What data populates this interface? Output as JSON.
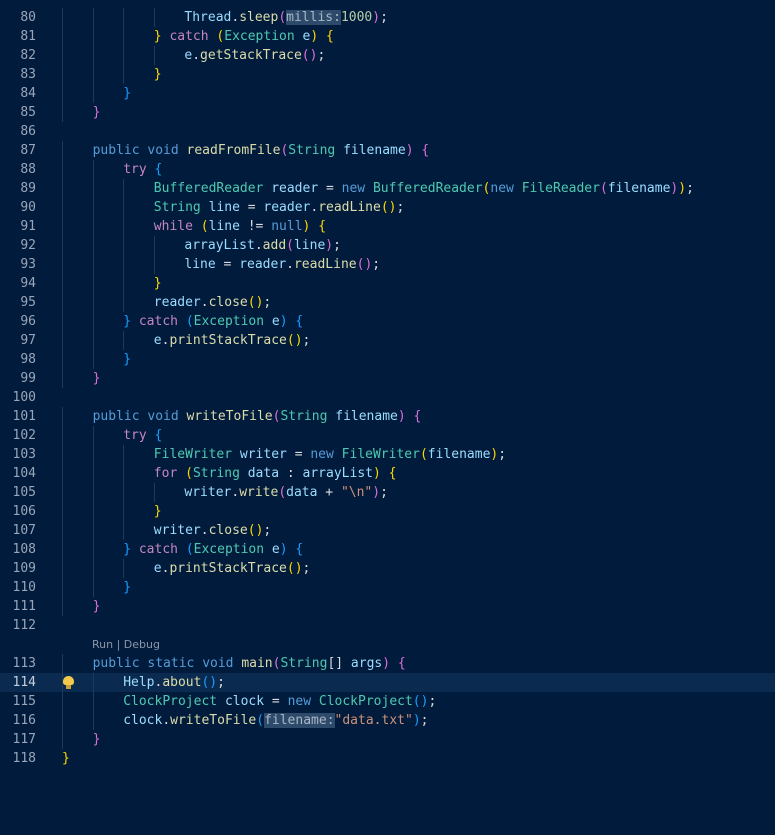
{
  "editor": {
    "current_line": 114,
    "codelens": "Run | Debug",
    "lines": [
      {
        "num": 80,
        "indent": 4,
        "tokens": [
          [
            "Thread",
            "v"
          ],
          [
            ".",
            ""
          ],
          [
            "sleep",
            "f"
          ],
          [
            "(",
            "m"
          ],
          [
            "millis:",
            "hint"
          ],
          [
            "1000",
            "n"
          ],
          [
            ")",
            "m"
          ],
          [
            ";",
            ""
          ]
        ]
      },
      {
        "num": 81,
        "indent": 3,
        "tokens": [
          [
            "}",
            "y"
          ],
          [
            " ",
            ""
          ],
          [
            "catch",
            "kc"
          ],
          [
            " ",
            ""
          ],
          [
            "(",
            "y"
          ],
          [
            "Exception",
            "t"
          ],
          [
            " ",
            ""
          ],
          [
            "e",
            "v"
          ],
          [
            ")",
            "y"
          ],
          [
            " ",
            ""
          ],
          [
            "{",
            "y"
          ]
        ]
      },
      {
        "num": 82,
        "indent": 4,
        "tokens": [
          [
            "e",
            "v"
          ],
          [
            ".",
            ""
          ],
          [
            "getStackTrace",
            "f"
          ],
          [
            "(",
            "m"
          ],
          [
            ")",
            "m"
          ],
          [
            ";",
            ""
          ]
        ]
      },
      {
        "num": 83,
        "indent": 3,
        "tokens": [
          [
            "}",
            "y"
          ]
        ]
      },
      {
        "num": 84,
        "indent": 2,
        "tokens": [
          [
            "}",
            "b"
          ]
        ]
      },
      {
        "num": 85,
        "indent": 1,
        "tokens": [
          [
            "}",
            "m"
          ]
        ]
      },
      {
        "num": 86,
        "indent": 0,
        "tokens": []
      },
      {
        "num": 87,
        "indent": 1,
        "tokens": [
          [
            "public",
            "k"
          ],
          [
            " ",
            ""
          ],
          [
            "void",
            "k"
          ],
          [
            " ",
            ""
          ],
          [
            "readFromFile",
            "f"
          ],
          [
            "(",
            "m"
          ],
          [
            "String",
            "t"
          ],
          [
            " ",
            ""
          ],
          [
            "filename",
            "v"
          ],
          [
            ")",
            "m"
          ],
          [
            " ",
            ""
          ],
          [
            "{",
            "m"
          ]
        ]
      },
      {
        "num": 88,
        "indent": 2,
        "tokens": [
          [
            "try",
            "kc"
          ],
          [
            " ",
            ""
          ],
          [
            "{",
            "b"
          ]
        ]
      },
      {
        "num": 89,
        "indent": 3,
        "tokens": [
          [
            "BufferedReader",
            "t"
          ],
          [
            " ",
            ""
          ],
          [
            "reader",
            "v"
          ],
          [
            " = ",
            ""
          ],
          [
            "new",
            "k"
          ],
          [
            " ",
            ""
          ],
          [
            "BufferedReader",
            "t"
          ],
          [
            "(",
            "y"
          ],
          [
            "new",
            "k"
          ],
          [
            " ",
            ""
          ],
          [
            "FileReader",
            "t"
          ],
          [
            "(",
            "m"
          ],
          [
            "filename",
            "v"
          ],
          [
            ")",
            "m"
          ],
          [
            ")",
            "y"
          ],
          [
            ";",
            ""
          ]
        ]
      },
      {
        "num": 90,
        "indent": 3,
        "tokens": [
          [
            "String",
            "t"
          ],
          [
            " ",
            ""
          ],
          [
            "line",
            "v"
          ],
          [
            " = ",
            ""
          ],
          [
            "reader",
            "v"
          ],
          [
            ".",
            ""
          ],
          [
            "readLine",
            "f"
          ],
          [
            "(",
            "y"
          ],
          [
            ")",
            "y"
          ],
          [
            ";",
            ""
          ]
        ]
      },
      {
        "num": 91,
        "indent": 3,
        "tokens": [
          [
            "while",
            "kc"
          ],
          [
            " ",
            ""
          ],
          [
            "(",
            "y"
          ],
          [
            "line",
            "v"
          ],
          [
            " != ",
            ""
          ],
          [
            "null",
            "k"
          ],
          [
            ")",
            "y"
          ],
          [
            " ",
            ""
          ],
          [
            "{",
            "y"
          ]
        ]
      },
      {
        "num": 92,
        "indent": 4,
        "tokens": [
          [
            "arrayList",
            "v"
          ],
          [
            ".",
            ""
          ],
          [
            "add",
            "f"
          ],
          [
            "(",
            "m"
          ],
          [
            "line",
            "v"
          ],
          [
            ")",
            "m"
          ],
          [
            ";",
            ""
          ]
        ]
      },
      {
        "num": 93,
        "indent": 4,
        "tokens": [
          [
            "line",
            "v"
          ],
          [
            " = ",
            ""
          ],
          [
            "reader",
            "v"
          ],
          [
            ".",
            ""
          ],
          [
            "readLine",
            "f"
          ],
          [
            "(",
            "m"
          ],
          [
            ")",
            "m"
          ],
          [
            ";",
            ""
          ]
        ]
      },
      {
        "num": 94,
        "indent": 3,
        "tokens": [
          [
            "}",
            "y"
          ]
        ]
      },
      {
        "num": 95,
        "indent": 3,
        "tokens": [
          [
            "reader",
            "v"
          ],
          [
            ".",
            ""
          ],
          [
            "close",
            "f"
          ],
          [
            "(",
            "y"
          ],
          [
            ")",
            "y"
          ],
          [
            ";",
            ""
          ]
        ]
      },
      {
        "num": 96,
        "indent": 2,
        "tokens": [
          [
            "}",
            "b"
          ],
          [
            " ",
            ""
          ],
          [
            "catch",
            "kc"
          ],
          [
            " ",
            ""
          ],
          [
            "(",
            "b"
          ],
          [
            "Exception",
            "t"
          ],
          [
            " ",
            ""
          ],
          [
            "e",
            "v"
          ],
          [
            ")",
            "b"
          ],
          [
            " ",
            ""
          ],
          [
            "{",
            "b"
          ]
        ]
      },
      {
        "num": 97,
        "indent": 3,
        "tokens": [
          [
            "e",
            "v"
          ],
          [
            ".",
            ""
          ],
          [
            "printStackTrace",
            "f"
          ],
          [
            "(",
            "y"
          ],
          [
            ")",
            "y"
          ],
          [
            ";",
            ""
          ]
        ]
      },
      {
        "num": 98,
        "indent": 2,
        "tokens": [
          [
            "}",
            "b"
          ]
        ]
      },
      {
        "num": 99,
        "indent": 1,
        "tokens": [
          [
            "}",
            "m"
          ]
        ]
      },
      {
        "num": 100,
        "indent": 0,
        "tokens": []
      },
      {
        "num": 101,
        "indent": 1,
        "tokens": [
          [
            "public",
            "k"
          ],
          [
            " ",
            ""
          ],
          [
            "void",
            "k"
          ],
          [
            " ",
            ""
          ],
          [
            "writeToFile",
            "f"
          ],
          [
            "(",
            "m"
          ],
          [
            "String",
            "t"
          ],
          [
            " ",
            ""
          ],
          [
            "filename",
            "v"
          ],
          [
            ")",
            "m"
          ],
          [
            " ",
            ""
          ],
          [
            "{",
            "m"
          ]
        ]
      },
      {
        "num": 102,
        "indent": 2,
        "tokens": [
          [
            "try",
            "kc"
          ],
          [
            " ",
            ""
          ],
          [
            "{",
            "b"
          ]
        ]
      },
      {
        "num": 103,
        "indent": 3,
        "tokens": [
          [
            "FileWriter",
            "t"
          ],
          [
            " ",
            ""
          ],
          [
            "writer",
            "v"
          ],
          [
            " = ",
            ""
          ],
          [
            "new",
            "k"
          ],
          [
            " ",
            ""
          ],
          [
            "FileWriter",
            "t"
          ],
          [
            "(",
            "y"
          ],
          [
            "filename",
            "v"
          ],
          [
            ")",
            "y"
          ],
          [
            ";",
            ""
          ]
        ]
      },
      {
        "num": 104,
        "indent": 3,
        "tokens": [
          [
            "for",
            "kc"
          ],
          [
            " ",
            ""
          ],
          [
            "(",
            "y"
          ],
          [
            "String",
            "t"
          ],
          [
            " ",
            ""
          ],
          [
            "data",
            "v"
          ],
          [
            " : ",
            ""
          ],
          [
            "arrayList",
            "v"
          ],
          [
            ")",
            "y"
          ],
          [
            " ",
            ""
          ],
          [
            "{",
            "y"
          ]
        ]
      },
      {
        "num": 105,
        "indent": 4,
        "tokens": [
          [
            "writer",
            "v"
          ],
          [
            ".",
            ""
          ],
          [
            "write",
            "f"
          ],
          [
            "(",
            "m"
          ],
          [
            "data",
            "v"
          ],
          [
            " + ",
            ""
          ],
          [
            "\"\\n\"",
            "s"
          ],
          [
            ")",
            "m"
          ],
          [
            ";",
            ""
          ]
        ]
      },
      {
        "num": 106,
        "indent": 3,
        "tokens": [
          [
            "}",
            "y"
          ]
        ]
      },
      {
        "num": 107,
        "indent": 3,
        "tokens": [
          [
            "writer",
            "v"
          ],
          [
            ".",
            ""
          ],
          [
            "close",
            "f"
          ],
          [
            "(",
            "y"
          ],
          [
            ")",
            "y"
          ],
          [
            ";",
            ""
          ]
        ]
      },
      {
        "num": 108,
        "indent": 2,
        "tokens": [
          [
            "}",
            "b"
          ],
          [
            " ",
            ""
          ],
          [
            "catch",
            "kc"
          ],
          [
            " ",
            ""
          ],
          [
            "(",
            "b"
          ],
          [
            "Exception",
            "t"
          ],
          [
            " ",
            ""
          ],
          [
            "e",
            "v"
          ],
          [
            ")",
            "b"
          ],
          [
            " ",
            ""
          ],
          [
            "{",
            "b"
          ]
        ]
      },
      {
        "num": 109,
        "indent": 3,
        "tokens": [
          [
            "e",
            "v"
          ],
          [
            ".",
            ""
          ],
          [
            "printStackTrace",
            "f"
          ],
          [
            "(",
            "y"
          ],
          [
            ")",
            "y"
          ],
          [
            ";",
            ""
          ]
        ]
      },
      {
        "num": 110,
        "indent": 2,
        "tokens": [
          [
            "}",
            "b"
          ]
        ]
      },
      {
        "num": 111,
        "indent": 1,
        "tokens": [
          [
            "}",
            "m"
          ]
        ]
      },
      {
        "num": 112,
        "indent": 0,
        "tokens": []
      },
      {
        "num": 113,
        "indent": 1,
        "codelens": true,
        "tokens": [
          [
            "public",
            "k"
          ],
          [
            " ",
            ""
          ],
          [
            "static",
            "k"
          ],
          [
            " ",
            ""
          ],
          [
            "void",
            "k"
          ],
          [
            " ",
            ""
          ],
          [
            "main",
            "f"
          ],
          [
            "(",
            "m"
          ],
          [
            "String",
            "t"
          ],
          [
            "[]",
            ""
          ],
          [
            " ",
            ""
          ],
          [
            "args",
            "v"
          ],
          [
            ")",
            "m"
          ],
          [
            " ",
            ""
          ],
          [
            "{",
            "m"
          ]
        ]
      },
      {
        "num": 114,
        "indent": 2,
        "tokens": [
          [
            "Help",
            "v"
          ],
          [
            ".",
            ""
          ],
          [
            "about",
            "f"
          ],
          [
            "(",
            "b"
          ],
          [
            ")",
            "b"
          ],
          [
            ";",
            ""
          ]
        ]
      },
      {
        "num": 115,
        "indent": 2,
        "tokens": [
          [
            "ClockProject",
            "t"
          ],
          [
            " ",
            ""
          ],
          [
            "clock",
            "v"
          ],
          [
            " = ",
            ""
          ],
          [
            "new",
            "k"
          ],
          [
            " ",
            ""
          ],
          [
            "ClockProject",
            "t"
          ],
          [
            "(",
            "b"
          ],
          [
            ")",
            "b"
          ],
          [
            ";",
            ""
          ]
        ]
      },
      {
        "num": 116,
        "indent": 2,
        "tokens": [
          [
            "clock",
            "v"
          ],
          [
            ".",
            ""
          ],
          [
            "writeToFile",
            "f"
          ],
          [
            "(",
            "b"
          ],
          [
            "filename:",
            "hint"
          ],
          [
            "\"data.txt\"",
            "s"
          ],
          [
            ")",
            "b"
          ],
          [
            ";",
            ""
          ]
        ]
      },
      {
        "num": 117,
        "indent": 1,
        "tokens": [
          [
            "}",
            "m"
          ]
        ]
      },
      {
        "num": 118,
        "indent": 0,
        "tokens": [
          [
            "}",
            "y"
          ]
        ]
      }
    ]
  }
}
